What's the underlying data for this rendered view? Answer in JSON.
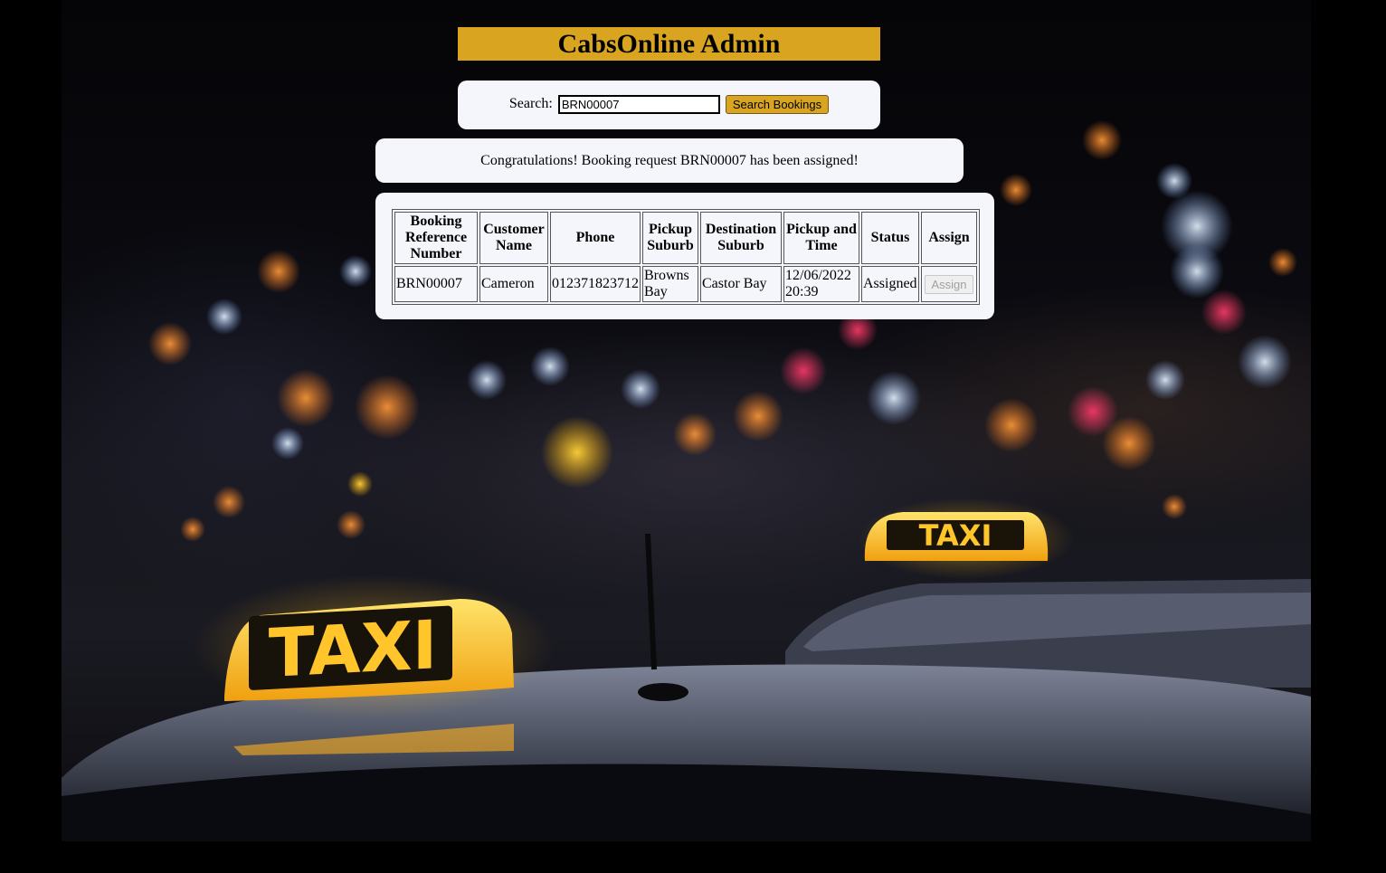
{
  "header": {
    "title": "CabsOnline Admin"
  },
  "search": {
    "label": "Search:",
    "value": "BRN00007",
    "button_label": "Search Bookings"
  },
  "message": {
    "text": "Congratulations! Booking request BRN00007 has been assigned!"
  },
  "table": {
    "headers": {
      "booking_ref": "Booking Reference Number",
      "customer": "Customer Name",
      "phone": "Phone",
      "pickup_suburb": "Pickup Suburb",
      "destination": "Destination Suburb",
      "pickup_time": "Pickup and Time",
      "status": "Status",
      "assign": "Assign"
    },
    "rows": [
      {
        "booking_ref": "BRN00007",
        "customer": "Cameron",
        "phone": "012371823712",
        "pickup_suburb": "Browns Bay",
        "destination": "Castor Bay",
        "pickup_time": "12/06/2022 20:39",
        "status": "Assigned",
        "assign_label": "Assign"
      }
    ]
  },
  "colors": {
    "accent": "#d9a520",
    "panel": "#f5f6fb",
    "page_background": "#000000"
  },
  "background_image": {
    "sign_text": "TAXI"
  }
}
